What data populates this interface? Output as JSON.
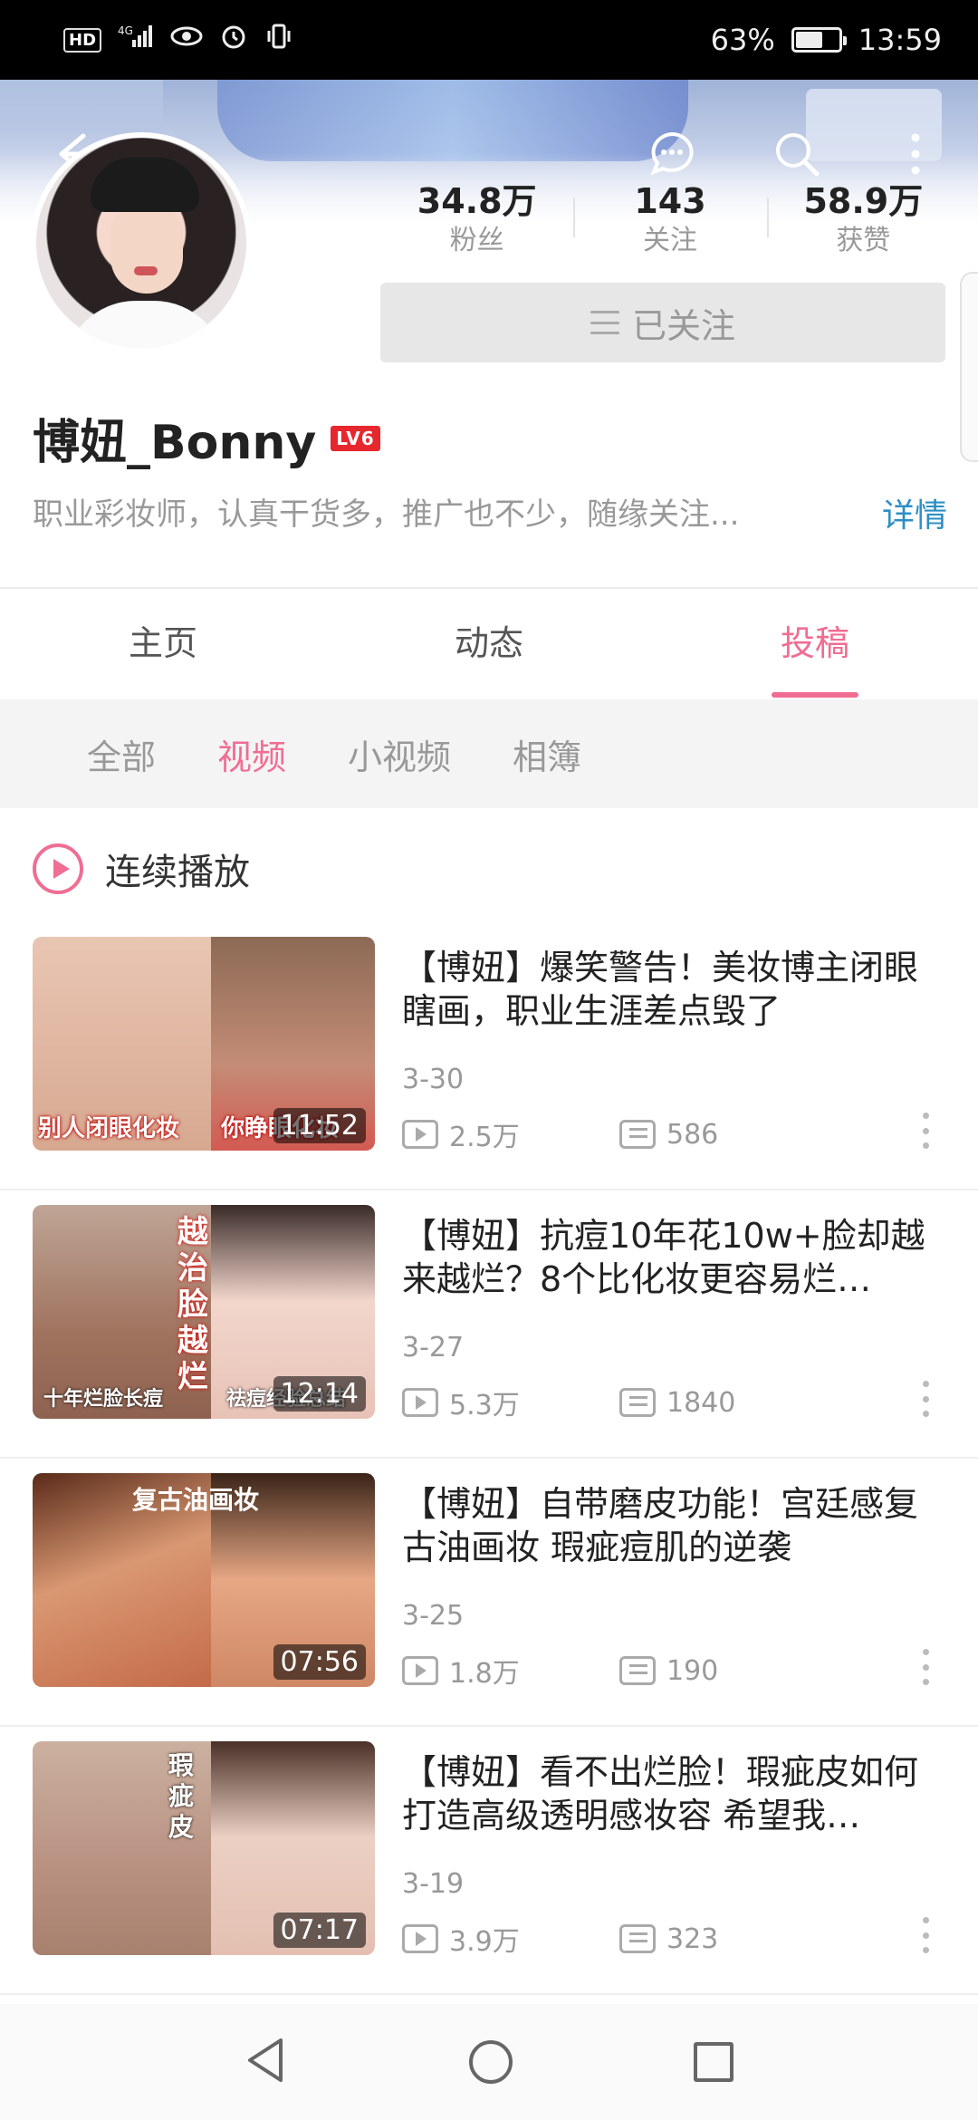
{
  "status_bar": {
    "hd": "HD",
    "network": "4G",
    "battery_percent": "63%",
    "battery_level": 0.63,
    "time": "13:59"
  },
  "profile": {
    "stats": [
      {
        "value": "34.8万",
        "label": "粉丝"
      },
      {
        "value": "143",
        "label": "关注"
      },
      {
        "value": "58.9万",
        "label": "获赞"
      }
    ],
    "follow_button": "已关注",
    "username": "博妞_Bonny",
    "level": "LV6",
    "bio": "职业彩妆师，认真干货多，推广也不少，随缘关注...",
    "detail_link": "详情"
  },
  "main_tabs": [
    {
      "label": "主页",
      "active": false
    },
    {
      "label": "动态",
      "active": false
    },
    {
      "label": "投稿",
      "active": true
    }
  ],
  "sub_tabs": [
    {
      "label": "全部",
      "active": false
    },
    {
      "label": "视频",
      "active": true
    },
    {
      "label": "小视频",
      "active": false
    },
    {
      "label": "相簿",
      "active": false
    }
  ],
  "continuous_play": "连续播放",
  "videos": [
    {
      "title": "【博妞】爆笑警告！美妆博主闭眼瞎画，职业生涯差点毁了",
      "date": "3-30",
      "views": "2.5万",
      "danmaku": "586",
      "duration": "11:52",
      "thumb_caption_left": "别人闭眼化妆",
      "thumb_caption_right": "你睁眼化妆",
      "thumb_vertical": ""
    },
    {
      "title": "【博妞】抗痘10年花10w+脸却越来越烂？8个比化妆更容易烂…",
      "date": "3-27",
      "views": "5.3万",
      "danmaku": "1840",
      "duration": "12:14",
      "thumb_caption_left": "十年烂脸长痘",
      "thumb_caption_right": "祛痘经验总结",
      "thumb_vertical": "越治脸越烂"
    },
    {
      "title": "【博妞】自带磨皮功能！宫廷感复古油画妆 瑕疵痘肌的逆袭",
      "date": "3-25",
      "views": "1.8万",
      "danmaku": "190",
      "duration": "07:56",
      "thumb_caption_left": "",
      "thumb_caption_right": "复古油画妆",
      "thumb_vertical": ""
    },
    {
      "title": "【博妞】看不出烂脸！瑕疵皮如何打造高级透明感妆容 希望我…",
      "date": "3-19",
      "views": "3.9万",
      "danmaku": "323",
      "duration": "07:17",
      "thumb_caption_left": "",
      "thumb_caption_right": "",
      "thumb_vertical": "瑕疵皮"
    }
  ],
  "colors": {
    "accent_pink": "#f06d93",
    "link_blue": "#2d8fc4",
    "level_red": "#e7272e"
  }
}
